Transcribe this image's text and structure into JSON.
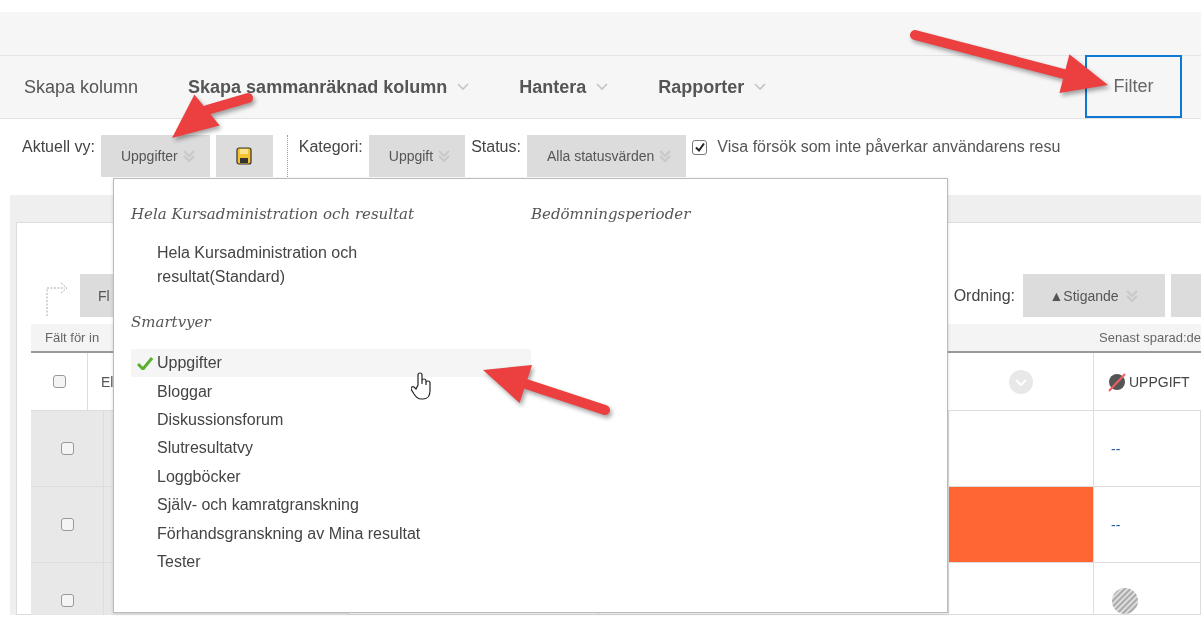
{
  "menu_bar": {
    "items": [
      {
        "label": "Skapa kolumn",
        "has_menu": false
      },
      {
        "label": "Skapa sammanräknad kolumn",
        "has_menu": true
      },
      {
        "label": "Hantera",
        "has_menu": true
      },
      {
        "label": "Rapporter",
        "has_menu": true
      }
    ],
    "filter_button": {
      "label": "Filter",
      "focused": true
    }
  },
  "toolbar": {
    "view_label": "Aktuell vy:",
    "view_value": "Uppgifter",
    "category_label": "Kategori:",
    "category_value": "Uppgift",
    "status_label": "Status:",
    "status_value": "Alla statusvärden",
    "show_attempts": {
      "label": "Visa försök som inte påverkar användarens resu",
      "checked": true
    }
  },
  "grade_center": {
    "move_button": "Fl",
    "order_label": "Ordning:",
    "order_value": "▲Stigande",
    "info_left": "Fält för in",
    "info_right": "Senast sparad:de",
    "header": {
      "checked": false,
      "column_1": "El",
      "column_2": "UPPGIFT"
    },
    "rows": [
      {
        "checked": false,
        "kind": "text",
        "grade": "--"
      },
      {
        "checked": false,
        "kind": "text",
        "grade": "--",
        "color": "#ff6633"
      },
      {
        "checked": false,
        "kind": "hatched"
      }
    ]
  },
  "view_menu": {
    "side_heading": "Bedömningsperioder",
    "groups": [
      {
        "heading": "Hela Kursadministration och resultat",
        "items": [
          {
            "label": "Hela Kursadministration och resultat(Standard)",
            "selected": false
          }
        ]
      },
      {
        "heading": "Smartvyer",
        "items": [
          {
            "label": "Uppgifter",
            "selected": true
          },
          {
            "label": "Bloggar",
            "selected": false
          },
          {
            "label": "Diskussionsforum",
            "selected": false
          },
          {
            "label": "Slutresultatvy",
            "selected": false
          },
          {
            "label": "Loggböcker",
            "selected": false
          },
          {
            "label": "Själv- och kamratgranskning",
            "selected": false
          },
          {
            "label": "Förhandsgranskning av Mina resultat",
            "selected": false
          },
          {
            "label": "Tester",
            "selected": false
          }
        ]
      }
    ]
  }
}
